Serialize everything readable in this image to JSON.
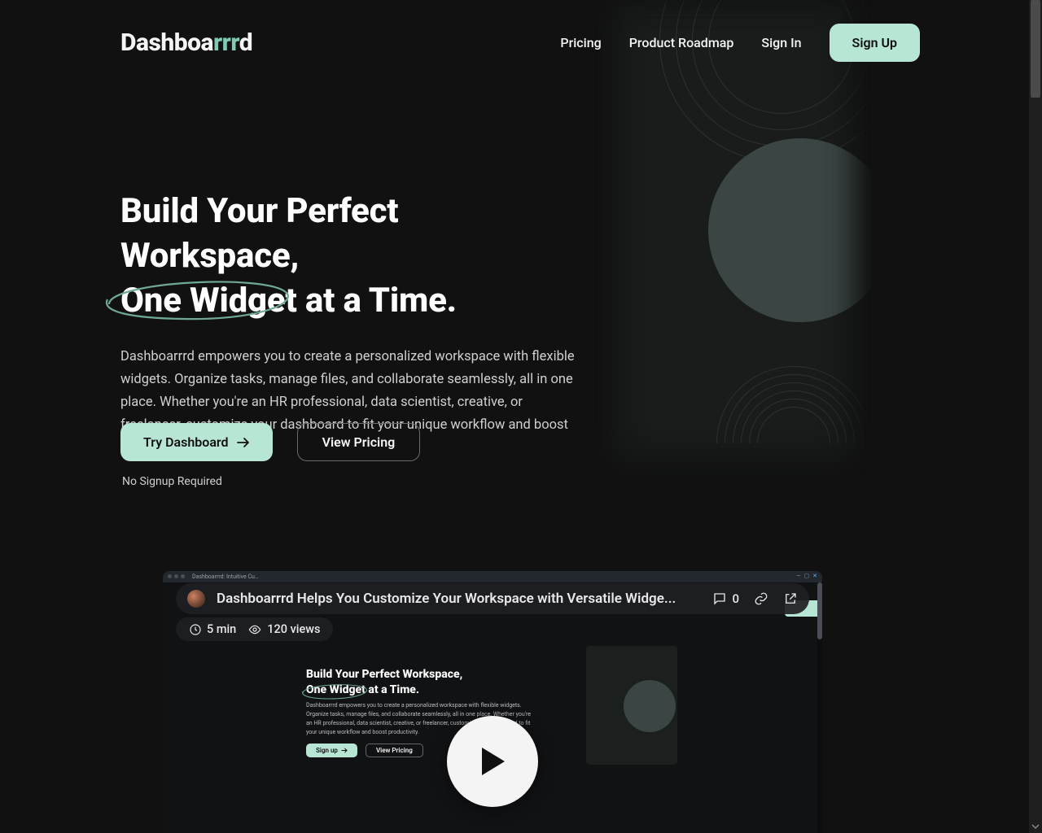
{
  "brand": {
    "name": "Dashboa",
    "accent": "rrr",
    "suffix": "d"
  },
  "nav": {
    "pricing": "Pricing",
    "roadmap": "Product Roadmap",
    "signin": "Sign In",
    "signup": "Sign Up"
  },
  "hero": {
    "line1": "Build Your Perfect Workspace,",
    "circled": "One Widget",
    "line2_rest": " at a Time.",
    "body": "Dashboarrrd empowers you to create a personalized workspace with flexible widgets. Organize tasks, manage files, and collaborate seamlessly, all in one place. Whether you're an HR professional, data scientist, creative, or freelancer, customize your dashboard to fit your unique workflow and boost productivity.",
    "cta_primary": "Try Dashboard",
    "cta_secondary": "View Pricing",
    "note": "No Signup Required"
  },
  "video": {
    "tab_title": "Dashboarrrd: Intuitive Cu…",
    "title": "Dashboarrrd Helps You Customize Your Workspace with Versatile Widge...",
    "comments": "0",
    "duration": "5 min",
    "views": "120 views",
    "inner": {
      "line1": "Build Your Perfect Workspace,",
      "circled": "One Widget",
      "line2_rest": " at a Time.",
      "body": "Dashboarrrd empowers you to create a personalized workspace with flexible widgets. Organize tasks, manage files, and collaborate seamlessly, all in one place. Whether you're an HR professional, data scientist, creative, or freelancer, customize your dashboard to fit your unique workflow and boost productivity.",
      "cta_primary": "Sign up",
      "cta_secondary": "View Pricing"
    }
  },
  "colors": {
    "accent": "#B8E6D5",
    "accent_deep": "#7FC9B5",
    "bg": "#111111"
  }
}
